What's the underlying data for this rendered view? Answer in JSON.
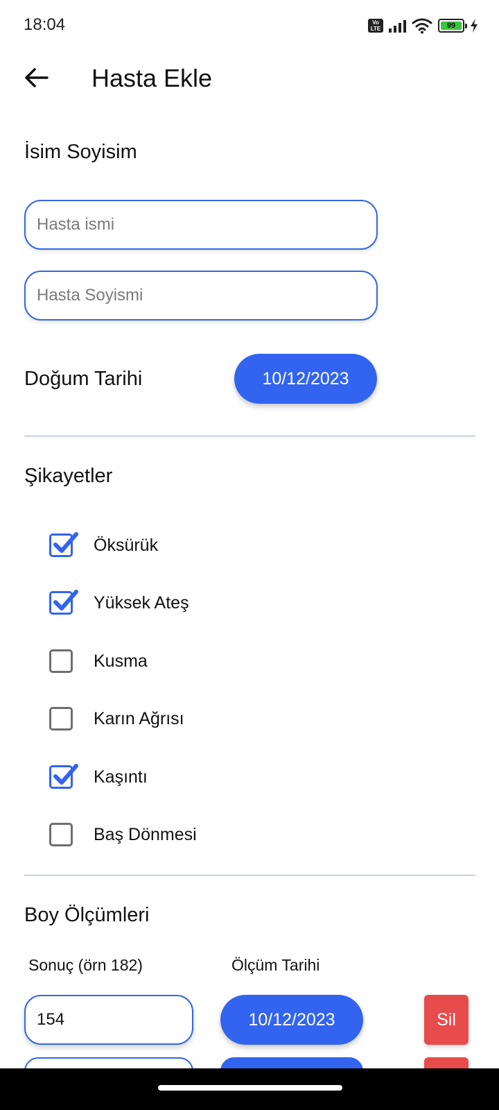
{
  "status_bar": {
    "time": "18:04",
    "volte_label_top": "Vo",
    "volte_label_bottom": "LTE",
    "battery_level": "99",
    "icons": [
      "volte-icon",
      "signal-icon",
      "wifi-icon",
      "battery-icon",
      "charging-icon"
    ]
  },
  "app_bar": {
    "back_icon": "arrow-left-icon",
    "title": "Hasta Ekle"
  },
  "name_section": {
    "title": "İsim Soyisim",
    "first_name": {
      "value": "",
      "placeholder": "Hasta ismi"
    },
    "last_name": {
      "value": "",
      "placeholder": "Hasta Soyismi"
    }
  },
  "birth_date": {
    "label": "Doğum Tarihi",
    "value": "10/12/2023"
  },
  "complaints": {
    "title": "Şikayetler",
    "items": [
      {
        "label": "Öksürük",
        "checked": true
      },
      {
        "label": "Yüksek Ateş",
        "checked": true
      },
      {
        "label": "Kusma",
        "checked": false
      },
      {
        "label": "Karın Ağrısı",
        "checked": false
      },
      {
        "label": "Kaşıntı",
        "checked": true
      },
      {
        "label": "Baş Dönmesi",
        "checked": false
      }
    ]
  },
  "height_measurements": {
    "title": "Boy Ölçümleri",
    "result_column_label": "Sonuç (örn 182)",
    "date_column_label": "Ölçüm Tarihi",
    "rows": [
      {
        "result": "154",
        "date": "10/12/2023",
        "delete_label": "Sil"
      }
    ]
  },
  "colors": {
    "accent": "#3264f0",
    "input_border": "#3566e6",
    "delete": "#e84b4b",
    "divider": "#9aa8c0"
  }
}
